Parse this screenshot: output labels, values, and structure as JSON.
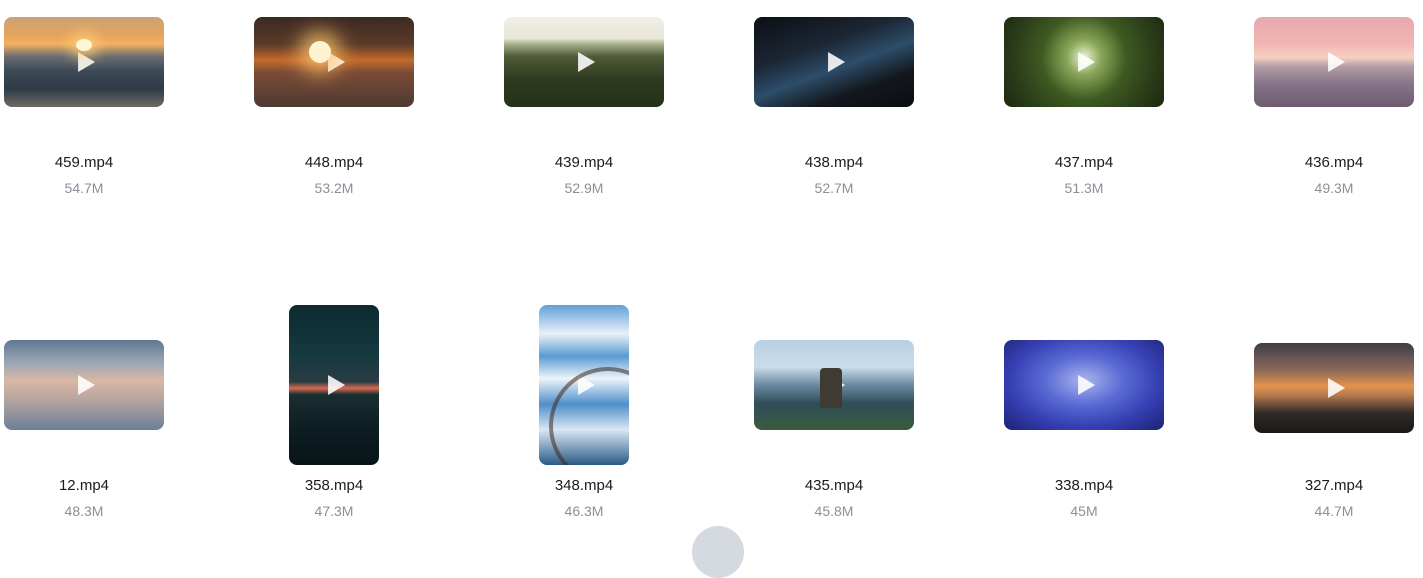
{
  "files": [
    {
      "name": "459.mp4",
      "size": "54.7M",
      "orientation": "landscape",
      "thumb": "sunset over ocean waves"
    },
    {
      "name": "448.mp4",
      "size": "53.2M",
      "orientation": "landscape",
      "thumb": "sunlit road under bridge"
    },
    {
      "name": "439.mp4",
      "size": "52.9M",
      "orientation": "landscape",
      "thumb": "forest aerial at dawn"
    },
    {
      "name": "438.mp4",
      "size": "52.7M",
      "orientation": "landscape",
      "thumb": "city river at night"
    },
    {
      "name": "437.mp4",
      "size": "51.3M",
      "orientation": "landscape",
      "thumb": "sun through tree canopy"
    },
    {
      "name": "436.mp4",
      "size": "49.3M",
      "orientation": "landscape",
      "thumb": "pink sky over sea"
    },
    {
      "name": "12.mp4",
      "size": "48.3M",
      "orientation": "landscape",
      "thumb": "clouds at sunset"
    },
    {
      "name": "358.mp4",
      "size": "47.3M",
      "orientation": "portrait",
      "thumb": "boat on calm sea at dusk"
    },
    {
      "name": "348.mp4",
      "size": "46.3M",
      "orientation": "portrait",
      "thumb": "ferris wheel and blue sky"
    },
    {
      "name": "435.mp4",
      "size": "45.8M",
      "orientation": "landscape",
      "thumb": "rocky coastal tower"
    },
    {
      "name": "338.mp4",
      "size": "45M",
      "orientation": "landscape",
      "thumb": "blue clouds"
    },
    {
      "name": "327.mp4",
      "size": "44.7M",
      "orientation": "landscape",
      "thumb": "orange sunset clouds"
    }
  ],
  "icons": {
    "play": "play-icon",
    "loading": "loading-spinner"
  }
}
